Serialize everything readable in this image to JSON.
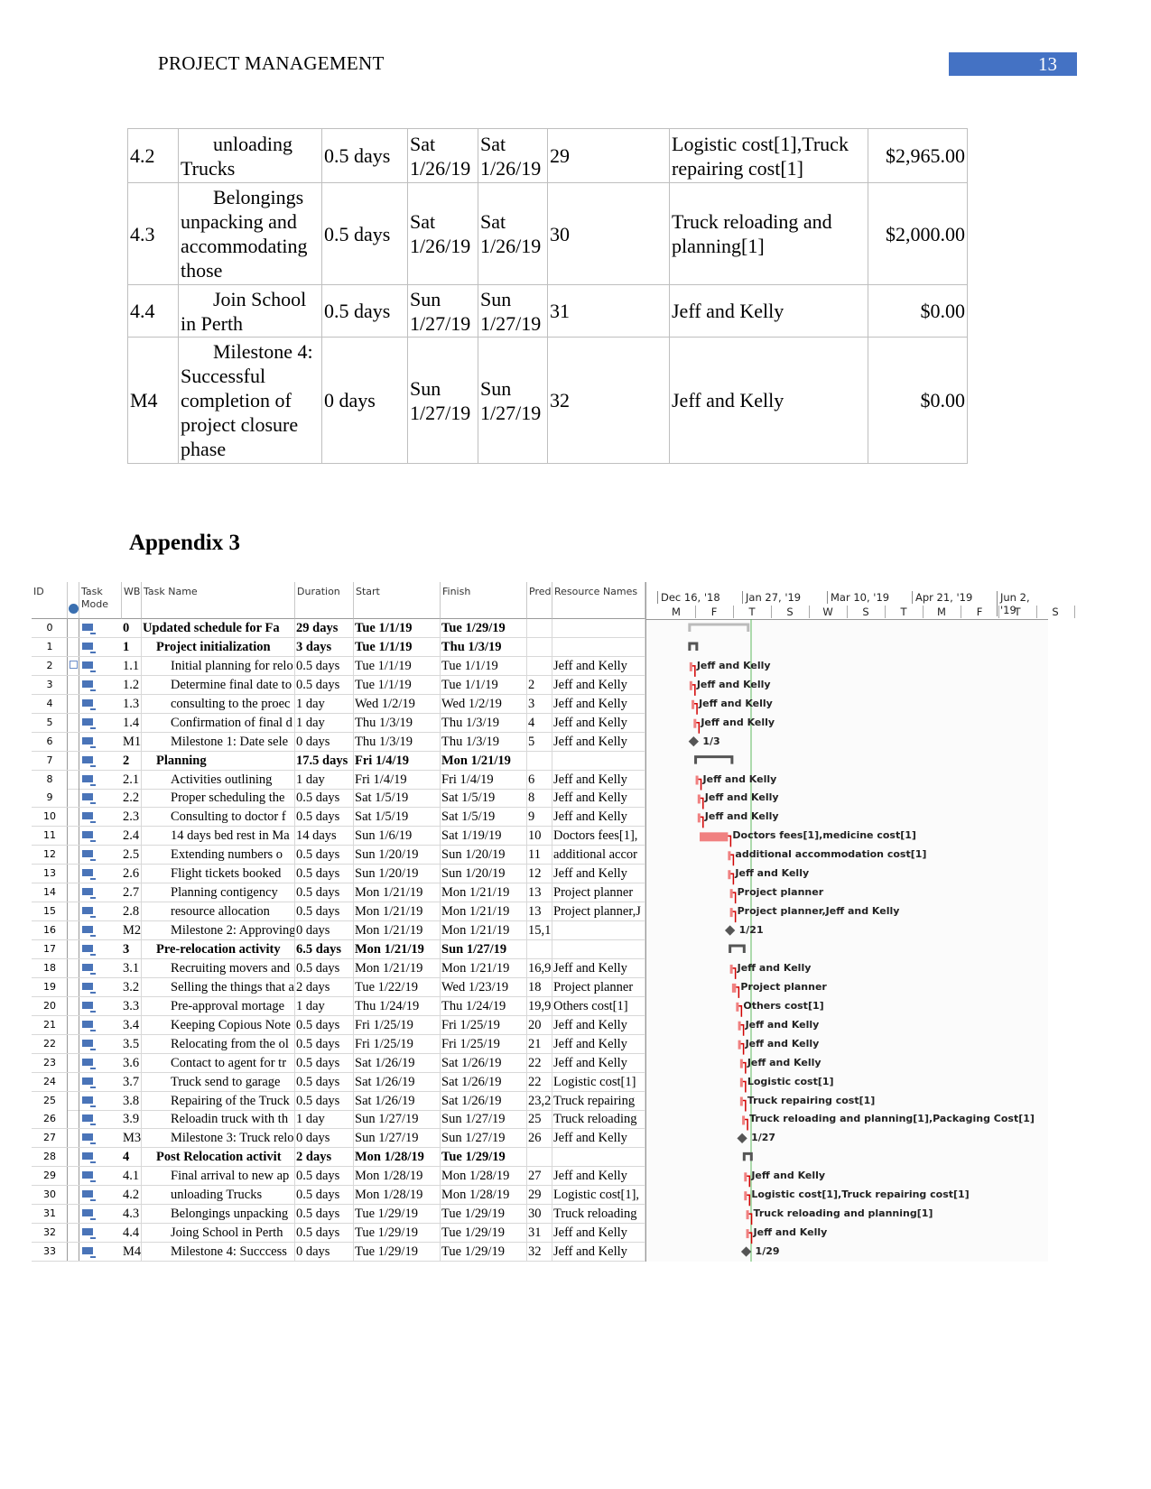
{
  "header": {
    "title": "PROJECT MANAGEMENT",
    "page_number": "13"
  },
  "cost_table": {
    "rows": [
      {
        "id": "4.2",
        "name": "unloading Trucks",
        "duration": "0.5 days",
        "start": "Sat 1/26/19",
        "finish": "Sat 1/26/19",
        "pred": "29",
        "resources": "Logistic cost[1],Truck repairing cost[1]",
        "cost": "$2,965.00"
      },
      {
        "id": "4.3",
        "name": "Belongings unpacking and accommodating those",
        "duration": "0.5 days",
        "start": "Sat 1/26/19",
        "finish": "Sat 1/26/19",
        "pred": "30",
        "resources": "Truck reloading and planning[1]",
        "cost": "$2,000.00"
      },
      {
        "id": "4.4",
        "name": "Join School in Perth",
        "duration": "0.5 days",
        "start": "Sun 1/27/19",
        "finish": "Sun 1/27/19",
        "pred": "31",
        "resources": "Jeff and Kelly",
        "cost": "$0.00"
      },
      {
        "id": "M4",
        "name": "Milestone 4: Successful completion of project closure phase",
        "duration": "0 days",
        "start": "Sun 1/27/19",
        "finish": "Sun 1/27/19",
        "pred": "32",
        "resources": "Jeff and Kelly",
        "cost": "$0.00"
      }
    ]
  },
  "appendix_title": "Appendix 3",
  "gantt": {
    "headers": {
      "id": "ID",
      "mode": "Task Mode",
      "wbs": "WB",
      "name": "Task Name",
      "duration": "Duration",
      "start": "Start",
      "finish": "Finish",
      "pred": "Pred",
      "resources": "Resource Names"
    },
    "timescale": {
      "major": [
        "Dec 16, '18",
        "Jan 27, '19",
        "Mar 10, '19",
        "Apr 21, '19",
        "Jun 2, '19"
      ],
      "minor": [
        "M",
        "F",
        "T",
        "S",
        "W",
        "S",
        "T",
        "M",
        "F",
        "T",
        "S"
      ]
    },
    "colors": {
      "task_bar": "#f08080",
      "critical_link": "#d00000",
      "summary": "#555555",
      "mode_icon": "#4a74b8"
    },
    "rows": [
      {
        "id": "0",
        "wbs": "0",
        "name": "Updated schedule for Fa",
        "duration": "29 days",
        "start": "Tue 1/1/19",
        "finish": "Tue 1/29/19",
        "pred": "",
        "res": "",
        "label": "",
        "type": "summary",
        "level": 0
      },
      {
        "id": "1",
        "wbs": "1",
        "name": "Project initialization",
        "duration": "3 days",
        "start": "Tue 1/1/19",
        "finish": "Thu 1/3/19",
        "pred": "",
        "res": "",
        "label": "",
        "type": "summary",
        "level": 1
      },
      {
        "id": "2",
        "wbs": "1.1",
        "name": "Initial planning for relo",
        "duration": "0.5 days",
        "start": "Tue 1/1/19",
        "finish": "Tue 1/1/19",
        "pred": "",
        "res": "Jeff and Kelly",
        "label": "Jeff and Kelly",
        "type": "task",
        "level": 2,
        "note": true
      },
      {
        "id": "3",
        "wbs": "1.2",
        "name": "Determine final date to",
        "duration": "0.5 days",
        "start": "Tue 1/1/19",
        "finish": "Tue 1/1/19",
        "pred": "2",
        "res": "Jeff and Kelly",
        "label": "Jeff and Kelly",
        "type": "task",
        "level": 2
      },
      {
        "id": "4",
        "wbs": "1.3",
        "name": "consulting to the proec",
        "duration": "1 day",
        "start": "Wed 1/2/19",
        "finish": "Wed 1/2/19",
        "pred": "3",
        "res": "Jeff and Kelly",
        "label": "Jeff and Kelly",
        "type": "task",
        "level": 2
      },
      {
        "id": "5",
        "wbs": "1.4",
        "name": "Confirmation of final d",
        "duration": "1 day",
        "start": "Thu 1/3/19",
        "finish": "Thu 1/3/19",
        "pred": "4",
        "res": "Jeff and Kelly",
        "label": "Jeff and Kelly",
        "type": "task",
        "level": 2
      },
      {
        "id": "6",
        "wbs": "M1",
        "name": "Milestone 1: Date sele",
        "duration": "0 days",
        "start": "Thu 1/3/19",
        "finish": "Thu 1/3/19",
        "pred": "5",
        "res": "Jeff and Kelly",
        "label": "1/3",
        "type": "milestone",
        "level": 2
      },
      {
        "id": "7",
        "wbs": "2",
        "name": "Planning",
        "duration": "17.5 days",
        "start": "Fri 1/4/19",
        "finish": "Mon 1/21/19",
        "pred": "",
        "res": "",
        "label": "",
        "type": "summary",
        "level": 1
      },
      {
        "id": "8",
        "wbs": "2.1",
        "name": "Activities outlining",
        "duration": "1 day",
        "start": "Fri 1/4/19",
        "finish": "Fri 1/4/19",
        "pred": "6",
        "res": "Jeff and Kelly",
        "label": "Jeff and Kelly",
        "type": "task",
        "level": 2
      },
      {
        "id": "9",
        "wbs": "2.2",
        "name": "Proper scheduling the",
        "duration": "0.5 days",
        "start": "Sat 1/5/19",
        "finish": "Sat 1/5/19",
        "pred": "8",
        "res": "Jeff and Kelly",
        "label": "Jeff and Kelly",
        "type": "task",
        "level": 2
      },
      {
        "id": "10",
        "wbs": "2.3",
        "name": "Consulting to doctor f",
        "duration": "0.5 days",
        "start": "Sat 1/5/19",
        "finish": "Sat 1/5/19",
        "pred": "9",
        "res": "Jeff and Kelly",
        "label": "Jeff and Kelly",
        "type": "task",
        "level": 2
      },
      {
        "id": "11",
        "wbs": "2.4",
        "name": "14 days bed rest in Ma",
        "duration": "14 days",
        "start": "Sun 1/6/19",
        "finish": "Sat 1/19/19",
        "pred": "10",
        "res": "Doctors fees[1],",
        "label": "Doctors fees[1],medicine cost[1]",
        "type": "task",
        "level": 2
      },
      {
        "id": "12",
        "wbs": "2.5",
        "name": "Extending numbers o",
        "duration": "0.5 days",
        "start": "Sun 1/20/19",
        "finish": "Sun 1/20/19",
        "pred": "11",
        "res": "additional accor",
        "label": "additional accommodation cost[1]",
        "type": "task",
        "level": 2
      },
      {
        "id": "13",
        "wbs": "2.6",
        "name": "Flight tickets booked",
        "duration": "0.5 days",
        "start": "Sun 1/20/19",
        "finish": "Sun 1/20/19",
        "pred": "12",
        "res": "Jeff and Kelly",
        "label": "Jeff and Kelly",
        "type": "task",
        "level": 2
      },
      {
        "id": "14",
        "wbs": "2.7",
        "name": "Planning contigency",
        "duration": "0.5 days",
        "start": "Mon 1/21/19",
        "finish": "Mon 1/21/19",
        "pred": "13",
        "res": "Project planner",
        "label": "Project planner",
        "type": "task",
        "level": 2
      },
      {
        "id": "15",
        "wbs": "2.8",
        "name": "resource allocation",
        "duration": "0.5 days",
        "start": "Mon 1/21/19",
        "finish": "Mon 1/21/19",
        "pred": "13",
        "res": "Project planner,J",
        "label": "Project planner,Jeff and Kelly",
        "type": "task",
        "level": 2
      },
      {
        "id": "16",
        "wbs": "M2",
        "name": "Milestone 2: Approving",
        "duration": "0 days",
        "start": "Mon 1/21/19",
        "finish": "Mon 1/21/19",
        "pred": "15,1",
        "res": "",
        "label": "1/21",
        "type": "milestone",
        "level": 2
      },
      {
        "id": "17",
        "wbs": "3",
        "name": "Pre-relocation activity",
        "duration": "6.5 days",
        "start": "Mon 1/21/19",
        "finish": "Sun 1/27/19",
        "pred": "",
        "res": "",
        "label": "",
        "type": "summary",
        "level": 1
      },
      {
        "id": "18",
        "wbs": "3.1",
        "name": "Recruiting movers and",
        "duration": "0.5 days",
        "start": "Mon 1/21/19",
        "finish": "Mon 1/21/19",
        "pred": "16,9",
        "res": "Jeff and Kelly",
        "label": "Jeff and Kelly",
        "type": "task",
        "level": 2
      },
      {
        "id": "19",
        "wbs": "3.2",
        "name": "Selling the things that a",
        "duration": "2 days",
        "start": "Tue 1/22/19",
        "finish": "Wed 1/23/19",
        "pred": "18",
        "res": "Project planner",
        "label": "Project planner",
        "type": "task",
        "level": 2
      },
      {
        "id": "20",
        "wbs": "3.3",
        "name": "Pre-approval mortage",
        "duration": "1 day",
        "start": "Thu 1/24/19",
        "finish": "Thu 1/24/19",
        "pred": "19,9",
        "res": "Others cost[1]",
        "label": "Others cost[1]",
        "type": "task",
        "level": 2
      },
      {
        "id": "21",
        "wbs": "3.4",
        "name": "Keeping Copious Note",
        "duration": "0.5 days",
        "start": "Fri 1/25/19",
        "finish": "Fri 1/25/19",
        "pred": "20",
        "res": "Jeff and Kelly",
        "label": "Jeff and Kelly",
        "type": "task",
        "level": 2
      },
      {
        "id": "22",
        "wbs": "3.5",
        "name": "Relocating from the ol",
        "duration": "0.5 days",
        "start": "Fri 1/25/19",
        "finish": "Fri 1/25/19",
        "pred": "21",
        "res": "Jeff and Kelly",
        "label": "Jeff and Kelly",
        "type": "task",
        "level": 2
      },
      {
        "id": "23",
        "wbs": "3.6",
        "name": "Contact to agent for tr",
        "duration": "0.5 days",
        "start": "Sat 1/26/19",
        "finish": "Sat 1/26/19",
        "pred": "22",
        "res": "Jeff and Kelly",
        "label": "Jeff and Kelly",
        "type": "task",
        "level": 2
      },
      {
        "id": "24",
        "wbs": "3.7",
        "name": "Truck send to garage",
        "duration": "0.5 days",
        "start": "Sat 1/26/19",
        "finish": "Sat 1/26/19",
        "pred": "22",
        "res": "Logistic cost[1]",
        "label": "Logistic cost[1]",
        "type": "task",
        "level": 2
      },
      {
        "id": "25",
        "wbs": "3.8",
        "name": "Repairing of the Truck",
        "duration": "0.5 days",
        "start": "Sat 1/26/19",
        "finish": "Sat 1/26/19",
        "pred": "23,2",
        "res": "Truck repairing",
        "label": "Truck repairing cost[1]",
        "type": "task",
        "level": 2
      },
      {
        "id": "26",
        "wbs": "3.9",
        "name": "Reloadin truck with th",
        "duration": "1 day",
        "start": "Sun 1/27/19",
        "finish": "Sun 1/27/19",
        "pred": "25",
        "res": "Truck reloading",
        "label": "Truck reloading and planning[1],Packaging Cost[1]",
        "type": "task",
        "level": 2
      },
      {
        "id": "27",
        "wbs": "M3",
        "name": "Milestone 3: Truck relo",
        "duration": "0 days",
        "start": "Sun 1/27/19",
        "finish": "Sun 1/27/19",
        "pred": "26",
        "res": "Jeff and Kelly",
        "label": "1/27",
        "type": "milestone",
        "level": 2
      },
      {
        "id": "28",
        "wbs": "4",
        "name": "Post Relocation activit",
        "duration": "2 days",
        "start": "Mon 1/28/19",
        "finish": "Tue 1/29/19",
        "pred": "",
        "res": "",
        "label": "",
        "type": "summary",
        "level": 1
      },
      {
        "id": "29",
        "wbs": "4.1",
        "name": "Final arrival to new ap",
        "duration": "0.5 days",
        "start": "Mon 1/28/19",
        "finish": "Mon 1/28/19",
        "pred": "27",
        "res": "Jeff and Kelly",
        "label": "Jeff and Kelly",
        "type": "task",
        "level": 2
      },
      {
        "id": "30",
        "wbs": "4.2",
        "name": "unloading Trucks",
        "duration": "0.5 days",
        "start": "Mon 1/28/19",
        "finish": "Mon 1/28/19",
        "pred": "29",
        "res": "Logistic cost[1],",
        "label": "Logistic cost[1],Truck repairing cost[1]",
        "type": "task",
        "level": 2
      },
      {
        "id": "31",
        "wbs": "4.3",
        "name": "Belongings unpacking",
        "duration": "0.5 days",
        "start": "Tue 1/29/19",
        "finish": "Tue 1/29/19",
        "pred": "30",
        "res": "Truck reloading",
        "label": "Truck reloading and planning[1]",
        "type": "task",
        "level": 2
      },
      {
        "id": "32",
        "wbs": "4.4",
        "name": "Joing School in Perth",
        "duration": "0.5 days",
        "start": "Tue 1/29/19",
        "finish": "Tue 1/29/19",
        "pred": "31",
        "res": "Jeff and Kelly",
        "label": "Jeff and Kelly",
        "type": "task",
        "level": 2
      },
      {
        "id": "33",
        "wbs": "M4",
        "name": "Milestone 4: Succcess",
        "duration": "0 days",
        "start": "Tue 1/29/19",
        "finish": "Tue 1/29/19",
        "pred": "32",
        "res": "Jeff and Kelly",
        "label": "1/29",
        "type": "milestone",
        "level": 2
      }
    ]
  }
}
